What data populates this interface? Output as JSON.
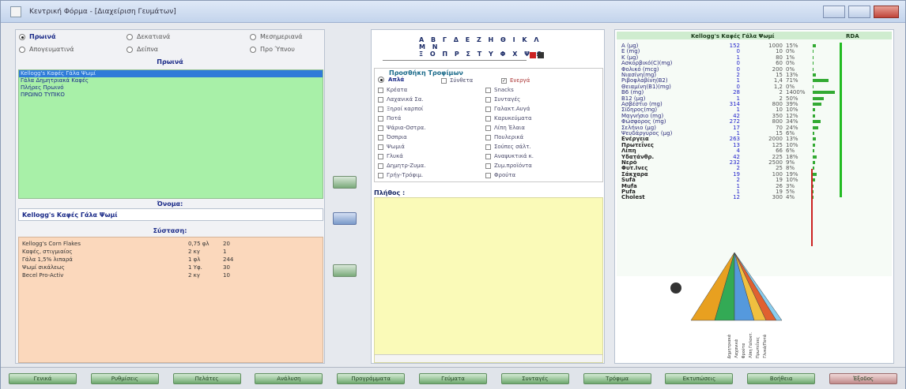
{
  "window": {
    "title": "Κεντρική Φόρμα - [Διαχείριση Γευμάτων]"
  },
  "left": {
    "radios": [
      {
        "label": "Πρωινά",
        "selected": true
      },
      {
        "label": "Δεκατιανά",
        "selected": false
      },
      {
        "label": "Μεσημεριανά",
        "selected": false
      },
      {
        "label": "Απογευματινά",
        "selected": false
      },
      {
        "label": "Δείπνα",
        "selected": false
      },
      {
        "label": "Προ Ύπνου",
        "selected": false
      }
    ],
    "section_title": "Πρωινά",
    "products": [
      {
        "label": "Kellogg's Καφές Γάλα Ψωμί",
        "selected": true
      },
      {
        "label": "Γάλα Δημητριακά Καφές",
        "selected": false
      },
      {
        "label": "Πλήρες Πρωινό",
        "selected": false
      },
      {
        "label": "ΠΡΩΙΝΟ ΤΥΠΙΚΟ",
        "selected": false
      }
    ],
    "name_label": "Όνομα:",
    "name_value": "Kellogg's Καφές Γάλα Ψωμί",
    "composition_label": "Σύσταση:",
    "ingredients": [
      {
        "name": "Kellogg's Corn Flakes",
        "qty": "0,75 φλ",
        "kcal": "20"
      },
      {
        "name": "Καφές, στιγμιαίος",
        "qty": "2 κγ",
        "kcal": "1"
      },
      {
        "name": "Γάλα 1,5% λιπαρά",
        "qty": "1 φλ",
        "kcal": "244"
      },
      {
        "name": "Ψωμί σικάλεως",
        "qty": "1 Υφ.",
        "kcal": "30"
      },
      {
        "name": "Becel Pro-Activ",
        "qty": "2 κγ",
        "kcal": "10"
      }
    ]
  },
  "middle": {
    "alphabet_row1": "Α Β Γ Δ Ε Ζ Η Θ Ι Κ Λ Μ Ν",
    "alphabet_row2": "Ξ Ο Π Ρ Σ Τ Υ Φ Χ Ψ Ω",
    "category_title": "Προσθήκη Τροφίμων",
    "mode_simple": "Απλά",
    "mode_complex": "Σύνθετα",
    "mode_active": "Ενεργά",
    "categories_left": [
      "Κρέατα",
      "Λαχανικά Σα.",
      "Ξηροί καρποί",
      "Ποτά",
      "Ψάρια-Οστρα.",
      "Όσπρια",
      "Ψωμιά",
      "Γλυκά",
      "Δημητρ-Ζυμα.",
      "Γρήγ-Τρόφιμ."
    ],
    "categories_right": [
      "Snacks",
      "Συνταγές",
      "Γαλακτ.Αυγά",
      "Καρυκεύματα",
      "Λίπη Έλαια",
      "Πουλερικά",
      "Σούπες σάλτ.",
      "Αναψυκτικά κ.",
      "Ζυμ.προϊόντα",
      "Φρούτα"
    ],
    "quantity_label": "Πλήθος :"
  },
  "right": {
    "header_title": "Kellogg's Καφές Γάλα Ψωμί",
    "header_rda": "RDA",
    "nutrients": [
      {
        "name": "A (μg)",
        "value": "152",
        "rda": "1000",
        "pct": "15%",
        "bar": 0.15
      },
      {
        "name": "E (mg)",
        "value": "0",
        "rda": "10",
        "pct": "0%",
        "bar": 0
      },
      {
        "name": "K (μg)",
        "value": "1",
        "rda": "80",
        "pct": "1%",
        "bar": 0.01
      },
      {
        "name": "Ασκορβικό(C)(mg)",
        "value": "0",
        "rda": "60",
        "pct": "0%",
        "bar": 0
      },
      {
        "name": "Φολικό (mcg)",
        "value": "0",
        "rda": "200",
        "pct": "0%",
        "bar": 0
      },
      {
        "name": "Νιασίνη(mg)",
        "value": "2",
        "rda": "15",
        "pct": "13%",
        "bar": 0.13
      },
      {
        "name": "Ριβοφλαβίνη(B2)",
        "value": "1",
        "rda": "1,4",
        "pct": "71%",
        "bar": 0.71
      },
      {
        "name": "Θειαμίνη(B1)(mg)",
        "value": "0",
        "rda": "1,2",
        "pct": "0%",
        "bar": 0
      },
      {
        "name": "B6 (mg)",
        "value": "28",
        "rda": "2",
        "pct": "1400%",
        "bar": 1
      },
      {
        "name": "B12 (μg)",
        "value": "1",
        "rda": "2",
        "pct": "50%",
        "bar": 0.5
      },
      {
        "name": "Ασβέστιο (mg)",
        "value": "314",
        "rda": "800",
        "pct": "39%",
        "bar": 0.39
      },
      {
        "name": "Σίδηρος(mg)",
        "value": "1",
        "rda": "10",
        "pct": "10%",
        "bar": 0.1
      },
      {
        "name": "Μαγνήσιο (mg)",
        "value": "42",
        "rda": "350",
        "pct": "12%",
        "bar": 0.12
      },
      {
        "name": "Φώσφορος (mg)",
        "value": "272",
        "rda": "800",
        "pct": "34%",
        "bar": 0.34
      },
      {
        "name": "Σελήνιο (μg)",
        "value": "17",
        "rda": "70",
        "pct": "24%",
        "bar": 0.24
      },
      {
        "name": "Ψευδάργυρος (μg)",
        "value": "1",
        "rda": "15",
        "pct": "6%",
        "bar": 0.06
      },
      {
        "name": "Ενέργεια",
        "value": "263",
        "rda": "2000",
        "pct": "13%",
        "bar": 0.13,
        "bold": true
      },
      {
        "name": "Πρωτεΐνες",
        "value": "13",
        "rda": "125",
        "pct": "10%",
        "bar": 0.1,
        "bold": true
      },
      {
        "name": "Λίπη",
        "value": "4",
        "rda": "66",
        "pct": "6%",
        "bar": 0.06,
        "bold": true
      },
      {
        "name": "Υδατάνθρ.",
        "value": "42",
        "rda": "225",
        "pct": "18%",
        "bar": 0.18,
        "bold": true
      },
      {
        "name": "Νερό",
        "value": "232",
        "rda": "2500",
        "pct": "9%",
        "bar": 0.09,
        "bold": true
      },
      {
        "name": "Φυτ.Ινες",
        "value": "2",
        "rda": "25",
        "pct": "8%",
        "bar": 0.08,
        "bold": true
      },
      {
        "name": "Σάκχαρα",
        "value": "19",
        "rda": "100",
        "pct": "19%",
        "bar": 0.19,
        "bold": true
      },
      {
        "name": "Sufa",
        "value": "2",
        "rda": "19",
        "pct": "10%",
        "bar": 0.1,
        "bold": true
      },
      {
        "name": "Mufa",
        "value": "1",
        "rda": "26",
        "pct": "3%",
        "bar": 0.03,
        "bold": true
      },
      {
        "name": "Pufa",
        "value": "1",
        "rda": "19",
        "pct": "5%",
        "bar": 0.05,
        "bold": true
      },
      {
        "name": "Cholest",
        "value": "12",
        "rda": "300",
        "pct": "4%",
        "bar": 0.04,
        "bold": true
      }
    ],
    "pyramid_legend": [
      "Δημητριακά",
      "Λαχανικά",
      "Φρούτα",
      "Λίπη Γαλακτ.",
      "Πρωτεΐνες",
      "Γλυκά/Ποτά"
    ],
    "pyramid_colors": [
      "#e8a020",
      "#33aa55",
      "#5599dd",
      "#f0c040",
      "#e06030",
      "#88ccee"
    ]
  },
  "bottom": {
    "buttons": [
      "Γενικά",
      "Ρυθμίσεις",
      "Πελάτες",
      "Ανάλυση",
      "Προγράμματα",
      "Γεύματα",
      "Συνταγές",
      "Τρόφιμα",
      "Εκτυπώσεις",
      "Βοήθεια",
      "Έξοδος"
    ]
  }
}
